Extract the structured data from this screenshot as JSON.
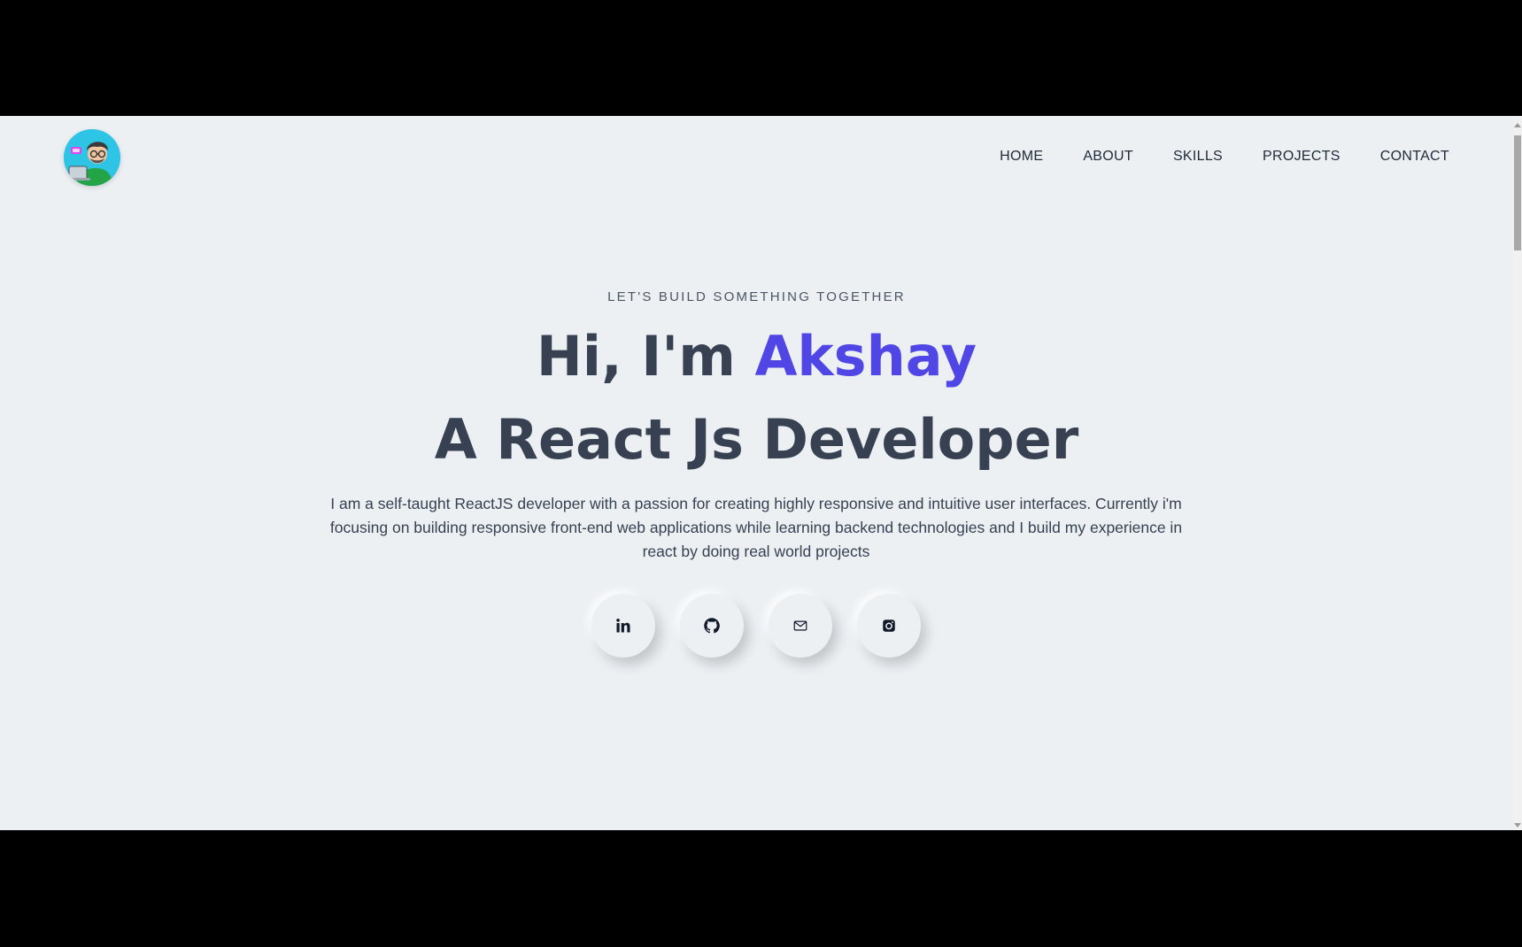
{
  "nav": {
    "items": [
      {
        "label": "HOME"
      },
      {
        "label": "ABOUT"
      },
      {
        "label": "SKILLS"
      },
      {
        "label": "PROJECTS"
      },
      {
        "label": "CONTACT"
      }
    ]
  },
  "logo": {
    "icon": "developer-avatar-icon"
  },
  "hero": {
    "eyebrow": "LET'S BUILD SOMETHING TOGETHER",
    "greeting": "Hi, I'm ",
    "name": "Akshay",
    "role": "A React Js Developer",
    "bio": "I am a self-taught ReactJS developer with a passion for creating highly responsive and intuitive user interfaces. Currently i'm focusing on building responsive front-end web applications while learning backend technologies and I build my experience in react by doing real world projects"
  },
  "socials": [
    {
      "icon": "linkedin-icon"
    },
    {
      "icon": "github-icon"
    },
    {
      "icon": "mail-icon"
    },
    {
      "icon": "instagram-icon"
    }
  ],
  "colors": {
    "background": "#ecf0f3",
    "accent": "#4f46e5",
    "heading": "#374151"
  }
}
